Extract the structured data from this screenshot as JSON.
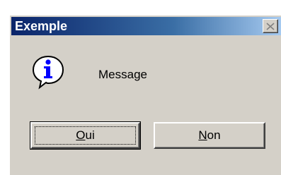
{
  "window": {
    "title": "Exemple",
    "close_icon": "close-icon"
  },
  "body": {
    "icon": "info-icon",
    "message": "Message"
  },
  "buttons": {
    "yes": {
      "mnemonic": "O",
      "rest": "ui",
      "full_label": "Oui"
    },
    "no": {
      "mnemonic": "N",
      "rest": "on",
      "full_label": "Non"
    }
  },
  "colors": {
    "titlebar_start": "#0a246a",
    "titlebar_end": "#a6caf0",
    "face": "#d4d0c8"
  }
}
